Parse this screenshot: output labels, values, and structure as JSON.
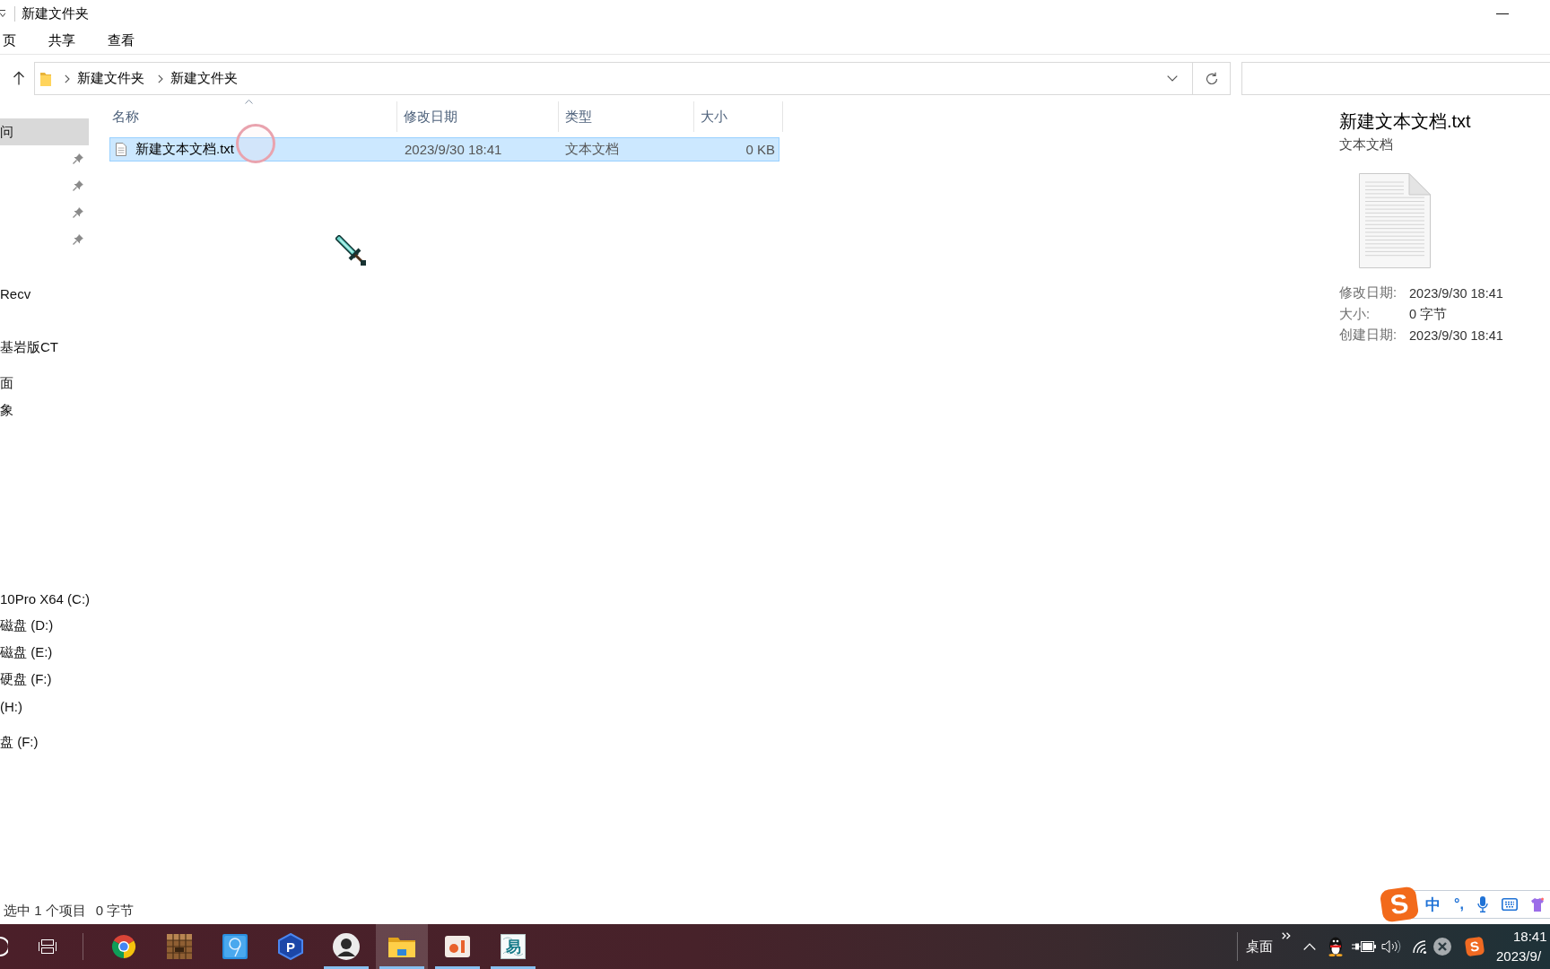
{
  "window": {
    "title": "新建文件夹"
  },
  "ribbon": {
    "tabs": [
      {
        "label": "页",
        "selected": false
      },
      {
        "label": "共享",
        "selected": false
      },
      {
        "label": "查看",
        "selected": false
      }
    ]
  },
  "address_bar": {
    "path": [
      "新建文件夹",
      "新建文件夹"
    ]
  },
  "sidebar": {
    "groups": [
      {
        "items": [
          {
            "label": "问",
            "selected": true,
            "pinned": false
          },
          {
            "selected": false,
            "pinned": true
          },
          {
            "selected": false,
            "pinned": true
          },
          {
            "selected": false,
            "pinned": true
          },
          {
            "selected": false,
            "pinned": true
          },
          {
            "selected": false,
            "pinned": false
          },
          {
            "label": "Recv",
            "selected": false,
            "pinned": false
          },
          {
            "selected": false,
            "pinned": false
          },
          {
            "label": "基岩版CT",
            "selected": false,
            "pinned": false
          }
        ]
      },
      {
        "items": [
          {
            "label": "面",
            "selected": false,
            "pinned": false
          },
          {
            "label": "象",
            "selected": false,
            "pinned": false
          },
          {
            "selected": false,
            "pinned": false
          },
          {
            "selected": false,
            "pinned": false
          },
          {
            "selected": false,
            "pinned": false
          },
          {
            "selected": false,
            "pinned": false
          },
          {
            "selected": false,
            "pinned": false
          },
          {
            "selected": false,
            "pinned": false
          },
          {
            "label": "10Pro X64 (C:)",
            "selected": false,
            "pinned": false
          },
          {
            "label": "磁盘 (D:)",
            "selected": false,
            "pinned": false
          },
          {
            "label": "磁盘 (E:)",
            "selected": false,
            "pinned": false
          },
          {
            "label": "硬盘 (F:)",
            "selected": false,
            "pinned": false
          },
          {
            "label": "(H:)",
            "selected": false,
            "pinned": false
          }
        ]
      },
      {
        "items": [
          {
            "label": "盘 (F:)",
            "selected": false,
            "pinned": false
          }
        ]
      }
    ]
  },
  "file_list": {
    "columns": [
      {
        "label": "名称",
        "sorted": true
      },
      {
        "label": "修改日期",
        "sorted": false
      },
      {
        "label": "类型",
        "sorted": false
      },
      {
        "label": "大小",
        "sorted": false
      }
    ],
    "rows": [
      {
        "name": "新建文本文档.txt",
        "modified": "2023/9/30 18:41",
        "type": "文本文档",
        "size": "0 KB",
        "selected": true
      }
    ]
  },
  "preview": {
    "title": "新建文本文档.txt",
    "subtitle": "文本文档",
    "details": [
      {
        "label": "修改日期:",
        "value": "2023/9/30 18:41"
      },
      {
        "label": "大小:",
        "value": "0 字节"
      },
      {
        "label": "创建日期:",
        "value": "2023/9/30 18:41"
      }
    ]
  },
  "status_bar": {
    "selection": "选中 1 个项目",
    "size": "0 字节"
  },
  "ime": {
    "logo": "S",
    "mode": "中",
    "punctuation": "°,"
  },
  "taskbar": {
    "apps": [
      {
        "kind": "browser",
        "active": false,
        "running": false
      },
      {
        "kind": "block",
        "active": false,
        "running": false
      },
      {
        "kind": "tile",
        "active": false,
        "running": false
      },
      {
        "kind": "hexagon",
        "glyph": "P",
        "active": false,
        "running": false
      },
      {
        "kind": "avatar",
        "active": false,
        "running": true
      },
      {
        "kind": "folder",
        "active": true,
        "running": true
      },
      {
        "kind": "slides",
        "active": false,
        "running": true
      },
      {
        "kind": "emblem",
        "glyph": "易",
        "active": false,
        "running": true
      }
    ],
    "toolbar_label": "桌面",
    "ime_glyph": "S",
    "clock": {
      "time": "18:41",
      "date": "2023/9/"
    }
  }
}
